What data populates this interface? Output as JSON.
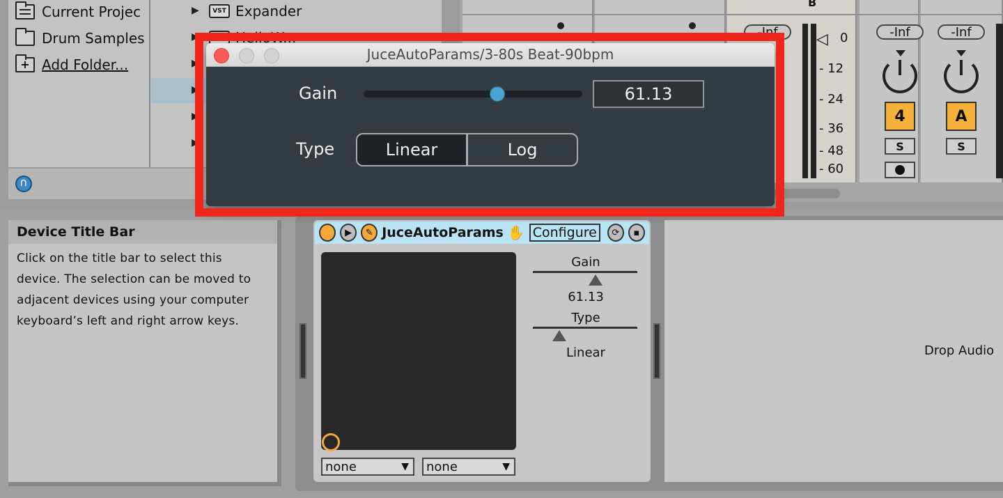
{
  "browser": {
    "places": [
      {
        "label": "Current Projec",
        "icon": "project-folder-icon"
      },
      {
        "label": "Drum Samples",
        "icon": "folder-icon"
      },
      {
        "label": "Add Folder...",
        "icon": "add-folder-icon"
      }
    ],
    "plugin_items": [
      {
        "badge": "VST",
        "label": "Expander"
      },
      {
        "badge": "VST",
        "label": "HelloW..."
      }
    ]
  },
  "mixer": {
    "track_header_letter": "B",
    "master_volume": "-Inf",
    "db_scale": [
      "0",
      "- 12",
      "- 24",
      "- 36",
      "- 48",
      "- 60"
    ],
    "tracks": [
      {
        "volume": "-Inf",
        "number": "4",
        "solo": "S",
        "has_arm": true
      },
      {
        "volume": "-Inf",
        "number": "A",
        "solo": "S",
        "has_arm": false
      }
    ],
    "track_color": "#f7b23b"
  },
  "info_view": {
    "title": "Device Title Bar",
    "body": "Click on the title bar to select this device. The selection can be moved to adjacent devices using your computer keyboard’s left and right arrow keys."
  },
  "device": {
    "name": "JuceAutoParams",
    "configure_label": "Configure",
    "params": [
      {
        "label": "Gain",
        "value": "61.13"
      },
      {
        "label": "Type",
        "value": "Linear"
      }
    ],
    "dropdowns": [
      "none",
      "none"
    ],
    "accent": "#f4a93a"
  },
  "drop_area": {
    "text": "Drop Audio"
  },
  "plugin_window": {
    "title": "JuceAutoParams/3-80s Beat-90bpm",
    "gain_label": "Gain",
    "gain_value": "61.13",
    "gain_fraction": 0.61,
    "type_label": "Type",
    "type_options": [
      "Linear",
      "Log"
    ],
    "type_selected": "Linear",
    "highlight_color": "#f0261c"
  }
}
